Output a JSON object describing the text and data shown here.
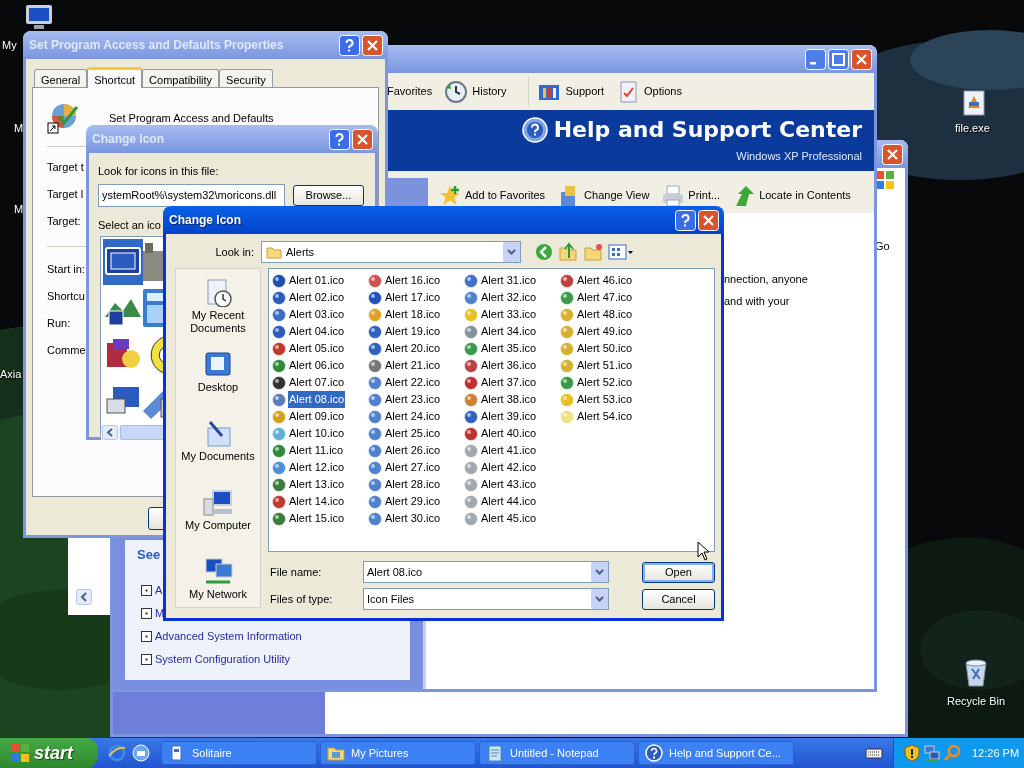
{
  "desktop_icons": [
    {
      "label": "My"
    },
    {
      "label": "M"
    },
    {
      "label": "M"
    },
    {
      "label": "Axia"
    },
    {
      "label": "file.exe"
    },
    {
      "label": "Recycle Bin"
    }
  ],
  "back_window": {
    "active": false,
    "go": "Go"
  },
  "help_window": {
    "active": false,
    "toolbar": [
      {
        "label": "Favorites"
      },
      {
        "label": "History"
      },
      {
        "label": "Support"
      },
      {
        "label": "Options"
      }
    ],
    "banner_title": "Help and Support Center",
    "banner_subtitle": "Windows XP Professional",
    "actions": [
      {
        "label": "Add to Favorites"
      },
      {
        "label": "Change View"
      },
      {
        "label": "Print..."
      },
      {
        "label": "Locate in Contents"
      }
    ],
    "see_also_title": "See",
    "see_also": [
      "A",
      "M",
      "Advanced System Information",
      "System Configuration Utility"
    ],
    "content_lines": [
      "nnection, anyone",
      "and with your"
    ]
  },
  "properties_window": {
    "active": false,
    "title": "Set Program Access and Defaults Properties",
    "tabs": [
      {
        "label": "General",
        "selected": false
      },
      {
        "label": "Shortcut",
        "selected": true
      },
      {
        "label": "Compatibility",
        "selected": false
      },
      {
        "label": "Security",
        "selected": false
      }
    ],
    "app_name": "Set Program Access and Defaults",
    "fields": [
      "Target t",
      "Target l",
      "Target:",
      "Start in:",
      "Shortcu",
      "Run:",
      "Comme"
    ]
  },
  "change_icon_small": {
    "active": false,
    "title": "Change Icon",
    "file_label": "Look for icons in this file:",
    "file_value": "ystemRoot%\\system32\\moricons.dll",
    "browse": "Browse...",
    "select_label": "Select an ico",
    "icons": [
      {
        "selected": true
      },
      {
        "selected": false
      },
      {
        "selected": false
      },
      {
        "selected": false
      },
      {
        "selected": false
      },
      {
        "selected": false
      },
      {
        "selected": false
      },
      {
        "selected": false
      }
    ]
  },
  "file_dialog": {
    "active": true,
    "title": "Change Icon",
    "look_in_label": "Look in:",
    "look_in_value": "Alerts",
    "places": [
      "My Recent Documents",
      "Desktop",
      "My Documents",
      "My Computer",
      "My Network"
    ],
    "files": [
      {
        "name": "Alert 01.ico",
        "selected": false,
        "color": "#1c4fb0"
      },
      {
        "name": "Alert 02.ico",
        "selected": false,
        "color": "#2a5cc0"
      },
      {
        "name": "Alert 03.ico",
        "selected": false,
        "color": "#3a6cc8"
      },
      {
        "name": "Alert 04.ico",
        "selected": false,
        "color": "#2a5cc0"
      },
      {
        "name": "Alert 05.ico",
        "selected": false,
        "color": "#c0392b"
      },
      {
        "name": "Alert 06.ico",
        "selected": false,
        "color": "#2e8b3a"
      },
      {
        "name": "Alert 07.ico",
        "selected": false,
        "color": "#333333"
      },
      {
        "name": "Alert 08.ico",
        "selected": true,
        "color": "#5b7db8"
      },
      {
        "name": "Alert 09.ico",
        "selected": false,
        "color": "#d4a017"
      },
      {
        "name": "Alert 10.ico",
        "selected": false,
        "color": "#5fb0d8"
      },
      {
        "name": "Alert 11.ico",
        "selected": false,
        "color": "#2e8b3a"
      },
      {
        "name": "Alert 12.ico",
        "selected": false,
        "color": "#4a90d9"
      },
      {
        "name": "Alert 13.ico",
        "selected": false,
        "color": "#3a7d3a"
      },
      {
        "name": "Alert 14.ico",
        "selected": false,
        "color": "#c0392b"
      },
      {
        "name": "Alert 15.ico",
        "selected": false,
        "color": "#3a7d3a"
      },
      {
        "name": "Alert 16.ico",
        "selected": false,
        "color": "#d05050"
      },
      {
        "name": "Alert 17.ico",
        "selected": false,
        "color": "#2050c0"
      },
      {
        "name": "Alert 18.ico",
        "selected": false,
        "color": "#e0a020"
      },
      {
        "name": "Alert 19.ico",
        "selected": false,
        "color": "#3060c0"
      },
      {
        "name": "Alert 20.ico",
        "selected": false,
        "color": "#3060c0"
      },
      {
        "name": "Alert 21.ico",
        "selected": false,
        "color": "#777777"
      },
      {
        "name": "Alert 22.ico",
        "selected": false,
        "color": "#5080d0"
      },
      {
        "name": "Alert 23.ico",
        "selected": false,
        "color": "#5080d0"
      },
      {
        "name": "Alert 24.ico",
        "selected": false,
        "color": "#5080d0"
      },
      {
        "name": "Alert 25.ico",
        "selected": false,
        "color": "#5080d0"
      },
      {
        "name": "Alert 26.ico",
        "selected": false,
        "color": "#5080d0"
      },
      {
        "name": "Alert 27.ico",
        "selected": false,
        "color": "#5080d0"
      },
      {
        "name": "Alert 28.ico",
        "selected": false,
        "color": "#5080d0"
      },
      {
        "name": "Alert 29.ico",
        "selected": false,
        "color": "#5080d0"
      },
      {
        "name": "Alert 30.ico",
        "selected": false,
        "color": "#5080d0"
      },
      {
        "name": "Alert 31.ico",
        "selected": false,
        "color": "#4070d0"
      },
      {
        "name": "Alert 32.ico",
        "selected": false,
        "color": "#5080d0"
      },
      {
        "name": "Alert 33.ico",
        "selected": false,
        "color": "#e8c020"
      },
      {
        "name": "Alert 34.ico",
        "selected": false,
        "color": "#8090a0"
      },
      {
        "name": "Alert 35.ico",
        "selected": false,
        "color": "#3a9a4a"
      },
      {
        "name": "Alert 36.ico",
        "selected": false,
        "color": "#c04040"
      },
      {
        "name": "Alert 37.ico",
        "selected": false,
        "color": "#c03030"
      },
      {
        "name": "Alert 38.ico",
        "selected": false,
        "color": "#d08030"
      },
      {
        "name": "Alert 39.ico",
        "selected": false,
        "color": "#3060c0"
      },
      {
        "name": "Alert 40.ico",
        "selected": false,
        "color": "#c03030"
      },
      {
        "name": "Alert 41.ico",
        "selected": false,
        "color": "#a0a8b0"
      },
      {
        "name": "Alert 42.ico",
        "selected": false,
        "color": "#a0a8b0"
      },
      {
        "name": "Alert 43.ico",
        "selected": false,
        "color": "#a0a8b0"
      },
      {
        "name": "Alert 44.ico",
        "selected": false,
        "color": "#a0a8b0"
      },
      {
        "name": "Alert 45.ico",
        "selected": false,
        "color": "#a0a8b0"
      },
      {
        "name": "Alert 46.ico",
        "selected": false,
        "color": "#c04040"
      },
      {
        "name": "Alert 47.ico",
        "selected": false,
        "color": "#3a9a4a"
      },
      {
        "name": "Alert 48.ico",
        "selected": false,
        "color": "#d8b030"
      },
      {
        "name": "Alert 49.ico",
        "selected": false,
        "color": "#d8b030"
      },
      {
        "name": "Alert 50.ico",
        "selected": false,
        "color": "#d8b030"
      },
      {
        "name": "Alert 51.ico",
        "selected": false,
        "color": "#d8b030"
      },
      {
        "name": "Alert 52.ico",
        "selected": false,
        "color": "#3a9a4a"
      },
      {
        "name": "Alert 53.ico",
        "selected": false,
        "color": "#e8c020"
      },
      {
        "name": "Alert 54.ico",
        "selected": false,
        "color": "#f0e080"
      }
    ],
    "file_name_label": "File name:",
    "file_name_value": "Alert 08.ico",
    "file_type_label": "Files of type:",
    "file_type_value": "Icon Files",
    "buttons": [
      {
        "label": "Open",
        "default": true
      },
      {
        "label": "Cancel",
        "default": false
      }
    ]
  },
  "taskbar": {
    "start": "start",
    "tasks": [
      "Solitaire",
      "My Pictures",
      "Untitled - Notepad",
      "Help and Support Ce..."
    ],
    "clock": "12:26 PM"
  }
}
